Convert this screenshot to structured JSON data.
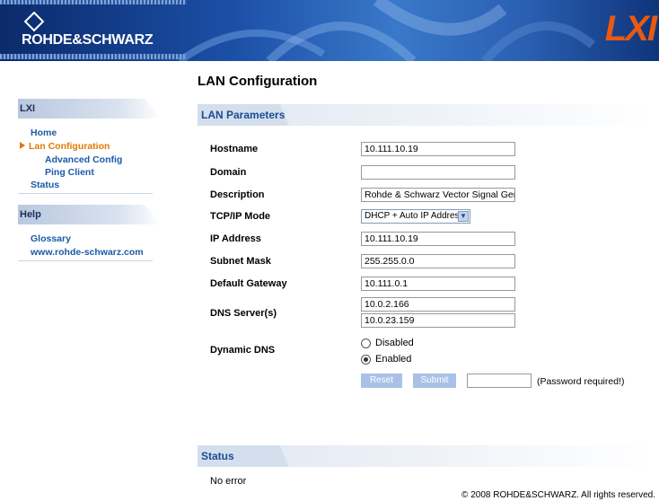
{
  "header": {
    "brand": "ROHDE&SCHWARZ",
    "lxi_logo": "LXI",
    "colors": {
      "banner": "#1b4fa6",
      "lxi": "#e85a12"
    }
  },
  "sidebar": {
    "sections": [
      {
        "title": "LXI"
      },
      {
        "title": "Help"
      }
    ],
    "lxi_items": [
      {
        "label": "Home"
      },
      {
        "label": "Lan Configuration",
        "active": true
      },
      {
        "label": "Advanced Config"
      },
      {
        "label": "Ping Client"
      },
      {
        "label": "Status"
      }
    ],
    "help_items": [
      {
        "label": "Glossary"
      },
      {
        "label": "www.rohde-schwarz.com"
      }
    ],
    "colors": {
      "link": "#1a5aa8",
      "active": "#e07a00"
    }
  },
  "main": {
    "title": "LAN Configuration",
    "lan_section": "LAN Parameters",
    "fields": {
      "hostname": {
        "label": "Hostname",
        "value": "10.111.10.19"
      },
      "domain": {
        "label": "Domain",
        "value": ""
      },
      "description": {
        "label": "Description",
        "value": "Rohde & Schwarz Vector Signal Generator SM"
      },
      "tcpip_mode": {
        "label": "TCP/IP Mode",
        "value": "DHCP + Auto IP Address"
      },
      "ip_address": {
        "label": "IP Address",
        "value": "10.111.10.19"
      },
      "subnet_mask": {
        "label": "Subnet Mask",
        "value": "255.255.0.0"
      },
      "default_gateway": {
        "label": "Default Gateway",
        "value": "10.111.0.1"
      },
      "dns_servers": {
        "label": "DNS Server(s)",
        "value1": "10.0.2.166",
        "value2": "10.0.23.159"
      },
      "dynamic_dns": {
        "label": "Dynamic DNS",
        "option_disabled": "Disabled",
        "option_enabled": "Enabled",
        "selected": "Enabled"
      }
    },
    "buttons": {
      "reset": "Reset",
      "submit": "Submit"
    },
    "password_note": "(Password required!)",
    "status_section": "Status",
    "status_text": "No error"
  },
  "footer": {
    "copyright": "© 2008 ROHDE&SCHWARZ. All rights reserved."
  }
}
